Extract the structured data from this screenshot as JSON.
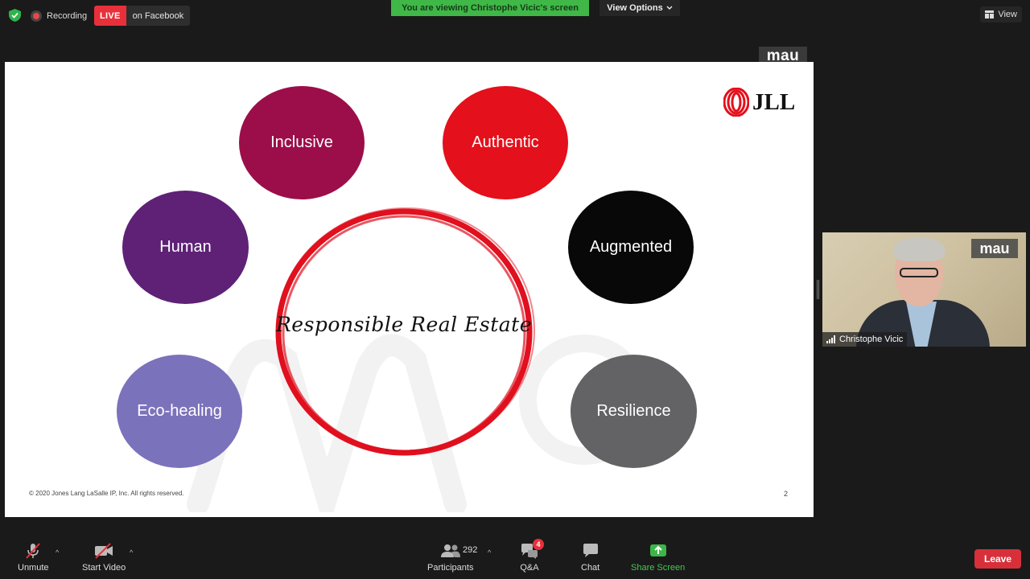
{
  "top_bar": {
    "recording_label": "Recording",
    "live_badge": "LIVE",
    "live_destination": "on Facebook",
    "viewing_banner": "You are viewing Christophe Vicic's screen",
    "view_options_label": "View Options",
    "view_label": "View"
  },
  "slide": {
    "watermark_tag": "mau",
    "bubbles": {
      "inclusive": "Inclusive",
      "authentic": "Authentic",
      "human": "Human",
      "augmented": "Augmented",
      "eco_healing": "Eco-healing",
      "resilience": "Resilience"
    },
    "center_text": "Responsible Real Estate",
    "logo_text": "JLL",
    "copyright": "© 2020 Jones Lang LaSalle IP, Inc. All rights reserved.",
    "page_number": "2",
    "colors": {
      "inclusive": "#9c0e4a",
      "authentic": "#e4101b",
      "human": "#5e2176",
      "augmented": "#080808",
      "eco_healing": "#7b72bc",
      "resilience": "#636366",
      "ring": "#e0101e"
    }
  },
  "participant_video": {
    "name": "Christophe Vicic",
    "watermark_tag": "mau"
  },
  "toolbar": {
    "unmute_label": "Unmute",
    "start_video_label": "Start Video",
    "participants_label": "Participants",
    "participants_count": "292",
    "qa_label": "Q&A",
    "qa_badge": "4",
    "chat_label": "Chat",
    "share_screen_label": "Share Screen",
    "leave_label": "Leave"
  }
}
